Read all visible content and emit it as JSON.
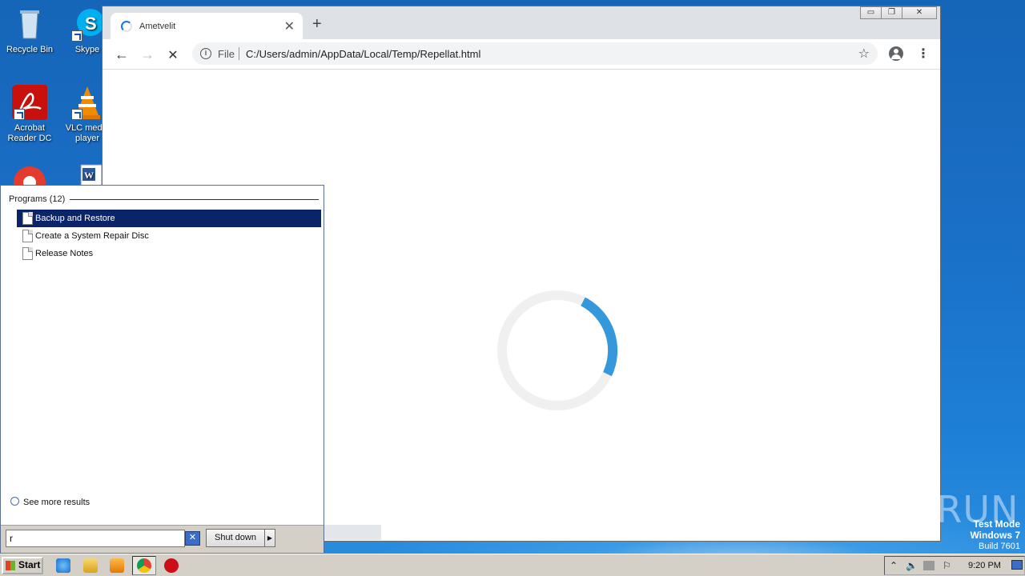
{
  "desktop": {
    "icons": [
      {
        "label": "Recycle Bin"
      },
      {
        "label": "Skype"
      },
      {
        "label": "Acrobat\nReader DC"
      },
      {
        "label": "VLC media\nplayer"
      }
    ]
  },
  "browser": {
    "tab_title": "Ametvelit",
    "tab_close": "✕",
    "new_tab": "+",
    "window_controls": {
      "minimize": "▭",
      "restore": "❐",
      "close": "✕"
    },
    "nav": {
      "back": "←",
      "forward": "→",
      "stop": "✕"
    },
    "omnibox": {
      "info": "i",
      "scheme_label": "File",
      "url": "C:/Users/admin/AppData/Local/Temp/Repellat.html"
    },
    "star": "☆",
    "menu": "⋮",
    "spinner_colors": {
      "track": "#f0f0f0",
      "arc": "#3498db"
    }
  },
  "start_menu": {
    "programs_header": "Programs (12)",
    "items": [
      {
        "label": "Backup and Restore",
        "selected": true
      },
      {
        "label": "Create a System Repair Disc",
        "selected": false
      },
      {
        "label": "Release Notes",
        "selected": false
      }
    ],
    "see_more": "See more results",
    "search_value": "r",
    "clear": "✕",
    "shutdown_label": "Shut down",
    "shutdown_arrow": "▶"
  },
  "taskbar": {
    "start_label": "Start",
    "tray": {
      "chevron": "⌃",
      "volume": "🔈",
      "flag": "⚐"
    },
    "clock": "9:20 PM"
  },
  "watermark": {
    "line1": "Test Mode",
    "line2": "Windows 7",
    "line3": "Build 7601",
    "brand": "ANY▷RUN"
  }
}
